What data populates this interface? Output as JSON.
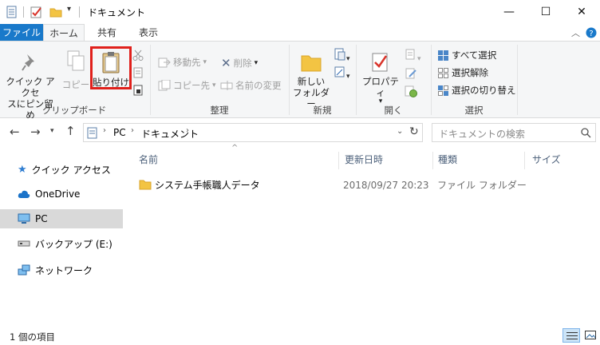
{
  "window": {
    "title": "ドキュメント",
    "minimize": "—",
    "maximize": "☐",
    "close": "✕"
  },
  "tabs": {
    "file": "ファイル",
    "home": "ホーム",
    "share": "共有",
    "view": "表示"
  },
  "ribbon": {
    "clipboard": {
      "group": "クリップボード",
      "quick_access_1": "クイック アクセ",
      "quick_access_2": "スにピン留め",
      "copy": "コピー",
      "paste": "貼り付け"
    },
    "organize": {
      "group": "整理",
      "move_to": "移動先",
      "copy_to": "コピー先",
      "delete": "削除",
      "rename": "名前の変更"
    },
    "new": {
      "group": "新規",
      "new_folder_1": "新しい",
      "new_folder_2": "フォルダー"
    },
    "open": {
      "group": "開く",
      "properties": "プロパティ"
    },
    "select": {
      "group": "選択",
      "select_all": "すべて選択",
      "select_none": "選択解除",
      "invert": "選択の切り替え"
    }
  },
  "address": {
    "path": [
      "PC",
      "ドキュメント"
    ],
    "search_placeholder": "ドキュメントの検索"
  },
  "nav": {
    "items": [
      "クイック アクセス",
      "OneDrive",
      "PC",
      "バックアップ (E:)",
      "ネットワーク"
    ]
  },
  "list": {
    "columns": [
      "名前",
      "更新日時",
      "種類",
      "サイズ"
    ],
    "rows": [
      {
        "name": "システム手帳職人データ",
        "modified": "2018/09/27 20:23",
        "type": "ファイル フォルダー",
        "size": ""
      }
    ]
  },
  "status": {
    "count": "1 個の項目"
  },
  "colors": {
    "file_tab": "#1979ca",
    "highlight_box": "#e0201b",
    "folder": "#f3c443"
  }
}
